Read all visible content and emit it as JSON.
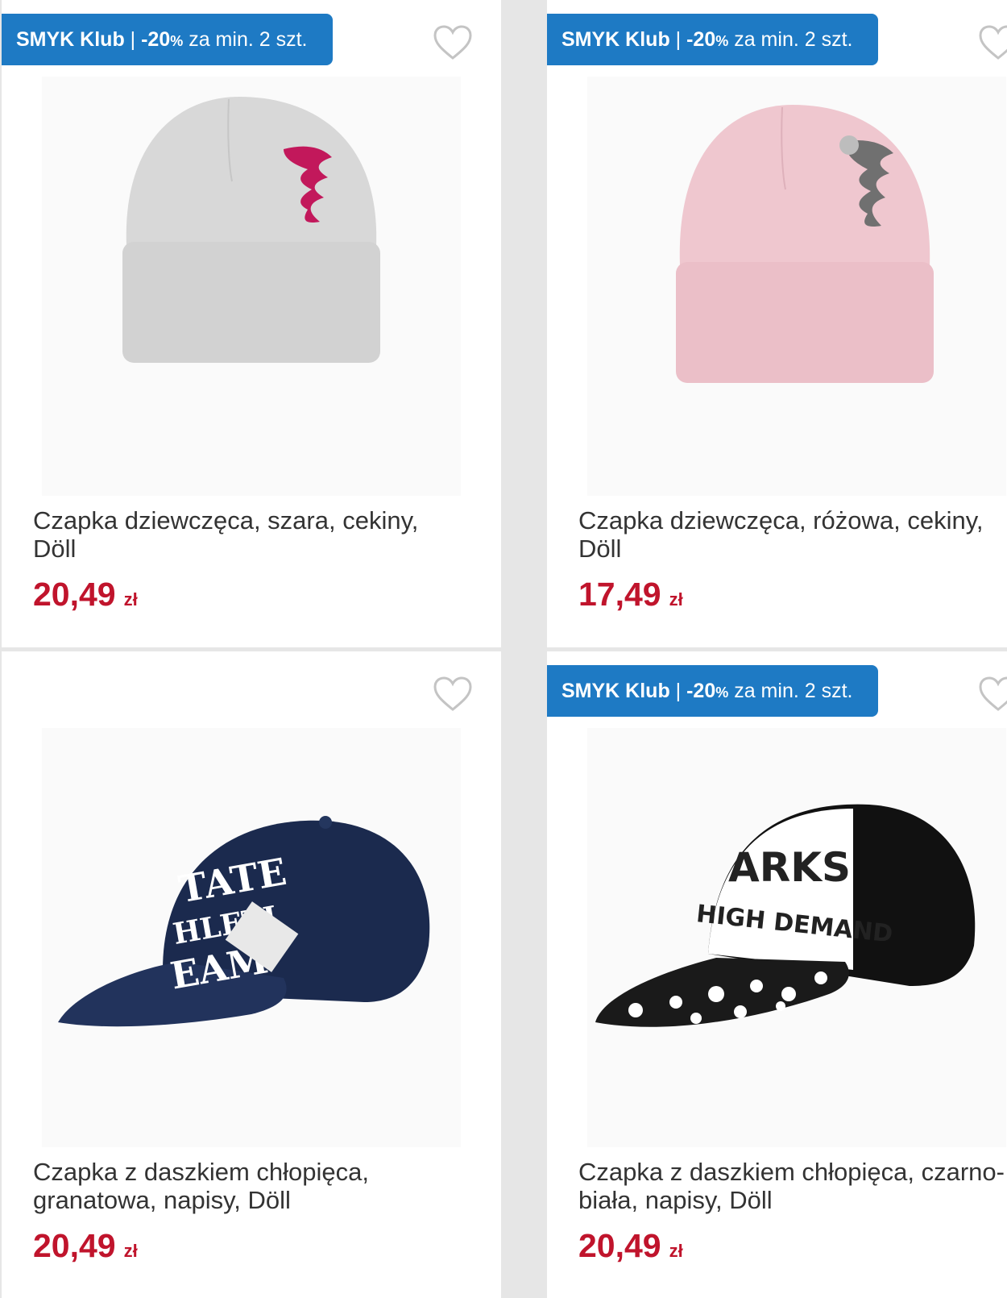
{
  "badge": {
    "brand": "SMYK Klub",
    "separator": " | ",
    "discount": "-20",
    "percent": "%",
    "condition": " za min. 2 szt."
  },
  "colors": {
    "badge": "#1e7ac4",
    "price": "#c0142c"
  },
  "products": [
    {
      "title": "Czapka dziewczęca, szara, cekiny, Döll",
      "price": "20,49",
      "currency": "zł",
      "has_badge": true,
      "image": "grey-beanie-pink-sequins"
    },
    {
      "title": "Czapka dziewczęca, różowa, cekiny, Döll",
      "price": "17,49",
      "currency": "zł",
      "has_badge": true,
      "image": "pink-beanie-silver-sequins"
    },
    {
      "title": "Czapka z daszkiem chłopięca, granatowa, napisy, Döll",
      "price": "20,49",
      "currency": "zł",
      "has_badge": false,
      "image": "navy-baseball-cap"
    },
    {
      "title": "Czapka z daszkiem chłopięca, czarno-biała, napisy, Döll",
      "price": "20,49",
      "currency": "zł",
      "has_badge": true,
      "image": "black-white-baseball-cap"
    }
  ],
  "icons": {
    "favorite": "heart-outline-icon"
  }
}
